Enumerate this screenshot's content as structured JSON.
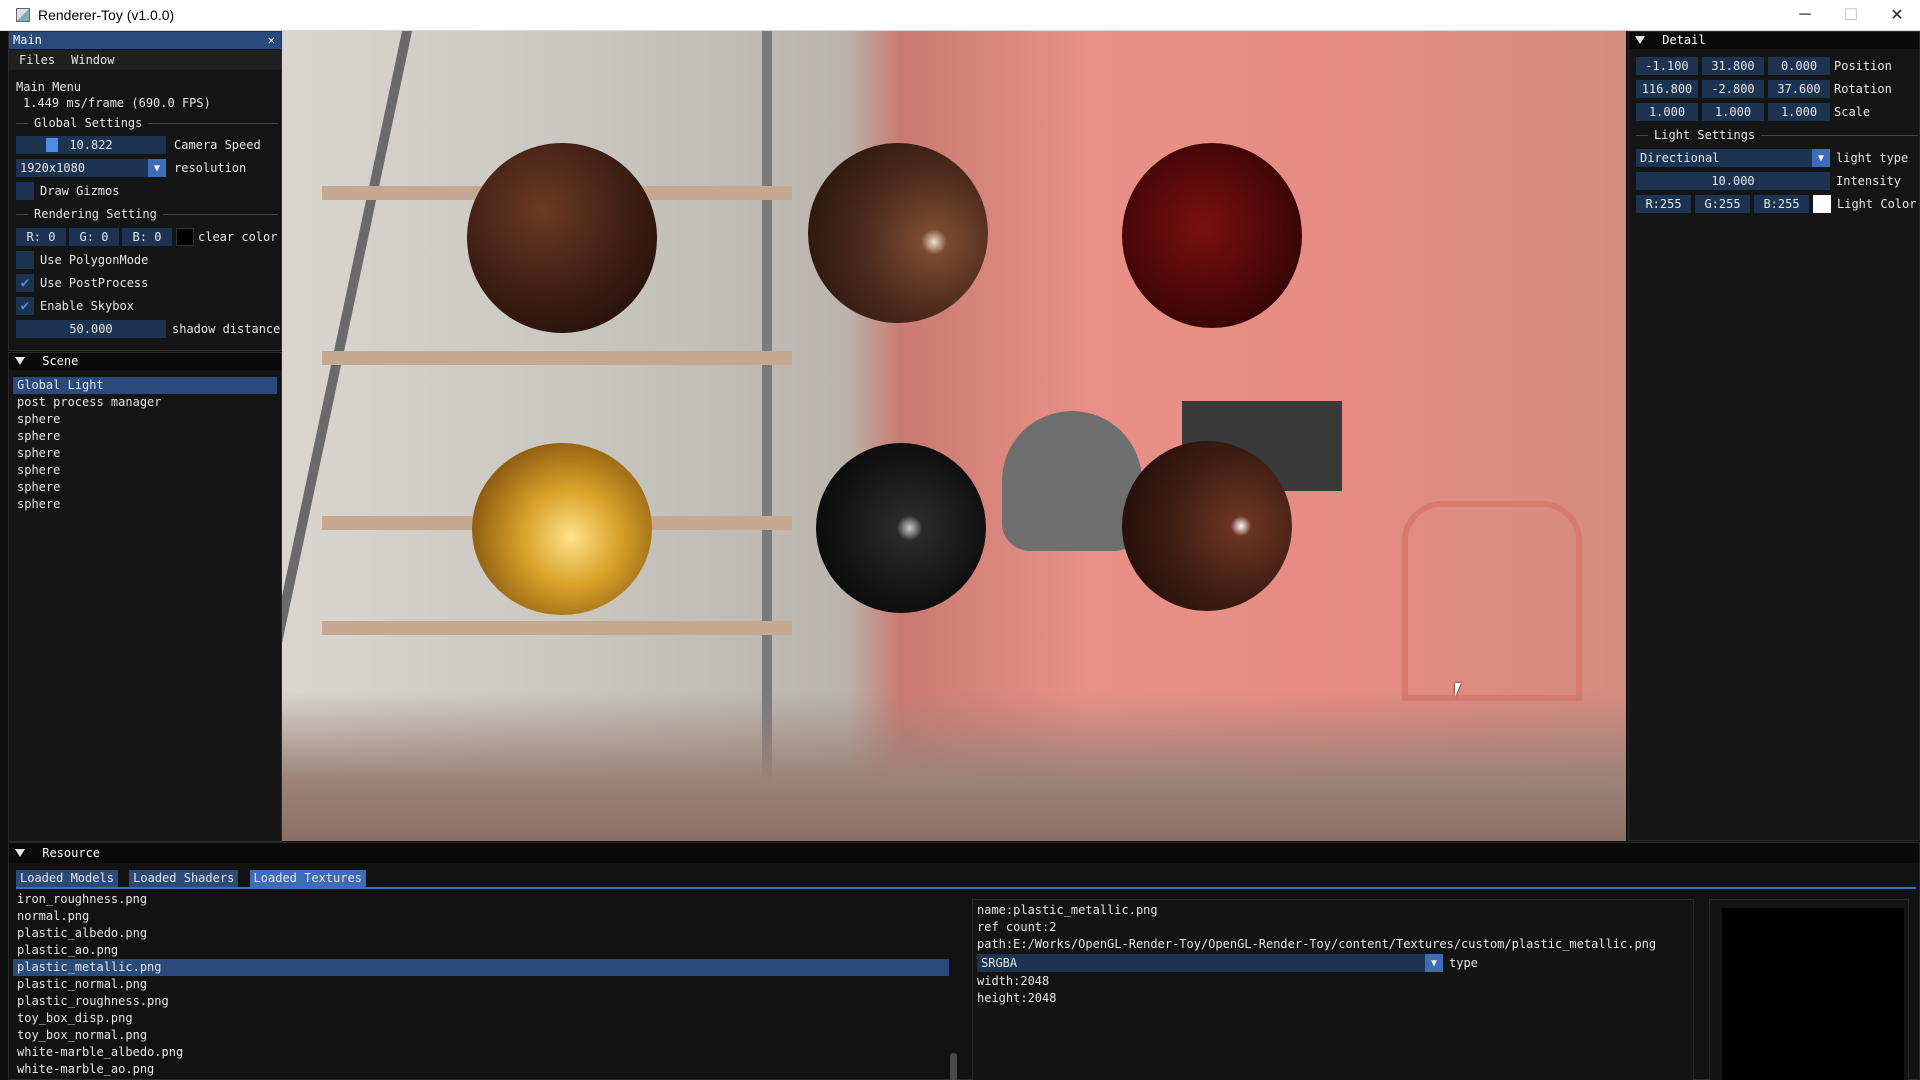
{
  "window": {
    "title": "Renderer-Toy (v1.0.0)",
    "minimize": "─",
    "maximize": "☐",
    "close": "✕"
  },
  "main_panel": {
    "title": "Main",
    "close": "✕",
    "menu": [
      "Files",
      "Window"
    ],
    "main_menu_label": "Main Menu",
    "fps": "1.449 ms/frame (690.0 FPS)",
    "global_settings": "Global Settings",
    "camera_speed": {
      "value": "10.822",
      "label": "Camera Speed"
    },
    "resolution": {
      "value": "1920x1080",
      "label": "resolution"
    },
    "draw_gizmos": "Draw Gizmos",
    "rendering_setting": "Rendering Setting",
    "clear_color": {
      "r": "R:  0",
      "g": "G:  0",
      "b": "B:  0",
      "label": "clear color"
    },
    "use_polygon_mode": "Use PolygonMode",
    "use_postprocess": "Use PostProcess",
    "enable_skybox": "Enable Skybox",
    "shadow_distance": {
      "value": "50.000",
      "label": "shadow distance"
    }
  },
  "scene_panel": {
    "title": "Scene",
    "items": [
      "Global Light",
      "post process manager",
      "sphere",
      "sphere",
      "sphere",
      "sphere",
      "sphere",
      "sphere"
    ]
  },
  "detail_panel": {
    "title": "Detail",
    "position": {
      "x": "-1.100",
      "y": "31.800",
      "z": "0.000",
      "label": "Position"
    },
    "rotation": {
      "x": "116.800",
      "y": "-2.800",
      "z": "37.600",
      "label": "Rotation"
    },
    "scale": {
      "x": "1.000",
      "y": "1.000",
      "z": "1.000",
      "label": "Scale"
    },
    "light_settings": "Light Settings",
    "light_type": {
      "value": "Directional",
      "label": "light type"
    },
    "intensity": {
      "value": "10.000",
      "label": "Intensity"
    },
    "light_color": {
      "r": "R:255",
      "g": "G:255",
      "b": "B:255",
      "label": "Light Color"
    }
  },
  "resource_panel": {
    "title": "Resource",
    "tabs": [
      "Loaded Models",
      "Loaded Shaders",
      "Loaded Textures"
    ],
    "textures": [
      "iron_roughness.png",
      "normal.png",
      "plastic_albedo.png",
      "plastic_ao.png",
      "plastic_metallic.png",
      "plastic_normal.png",
      "plastic_roughness.png",
      "toy_box_disp.png",
      "toy_box_normal.png",
      "white-marble_albedo.png",
      "white-marble_ao.png"
    ],
    "detail": {
      "name": "name:plastic_metallic.png",
      "ref_count": "ref count:2",
      "path": "path:E:/Works/OpenGL-Render-Toy/OpenGL-Render-Toy/content/Textures/custom/plastic_metallic.png",
      "format": "SRGBA",
      "format_label": "type",
      "width": "width:2048",
      "height": "height:2048"
    }
  },
  "colors": {
    "accent": "#294a7a",
    "frame_bg": "#1d3352",
    "check": "#4c8be6",
    "panel_bg": "#151515"
  }
}
